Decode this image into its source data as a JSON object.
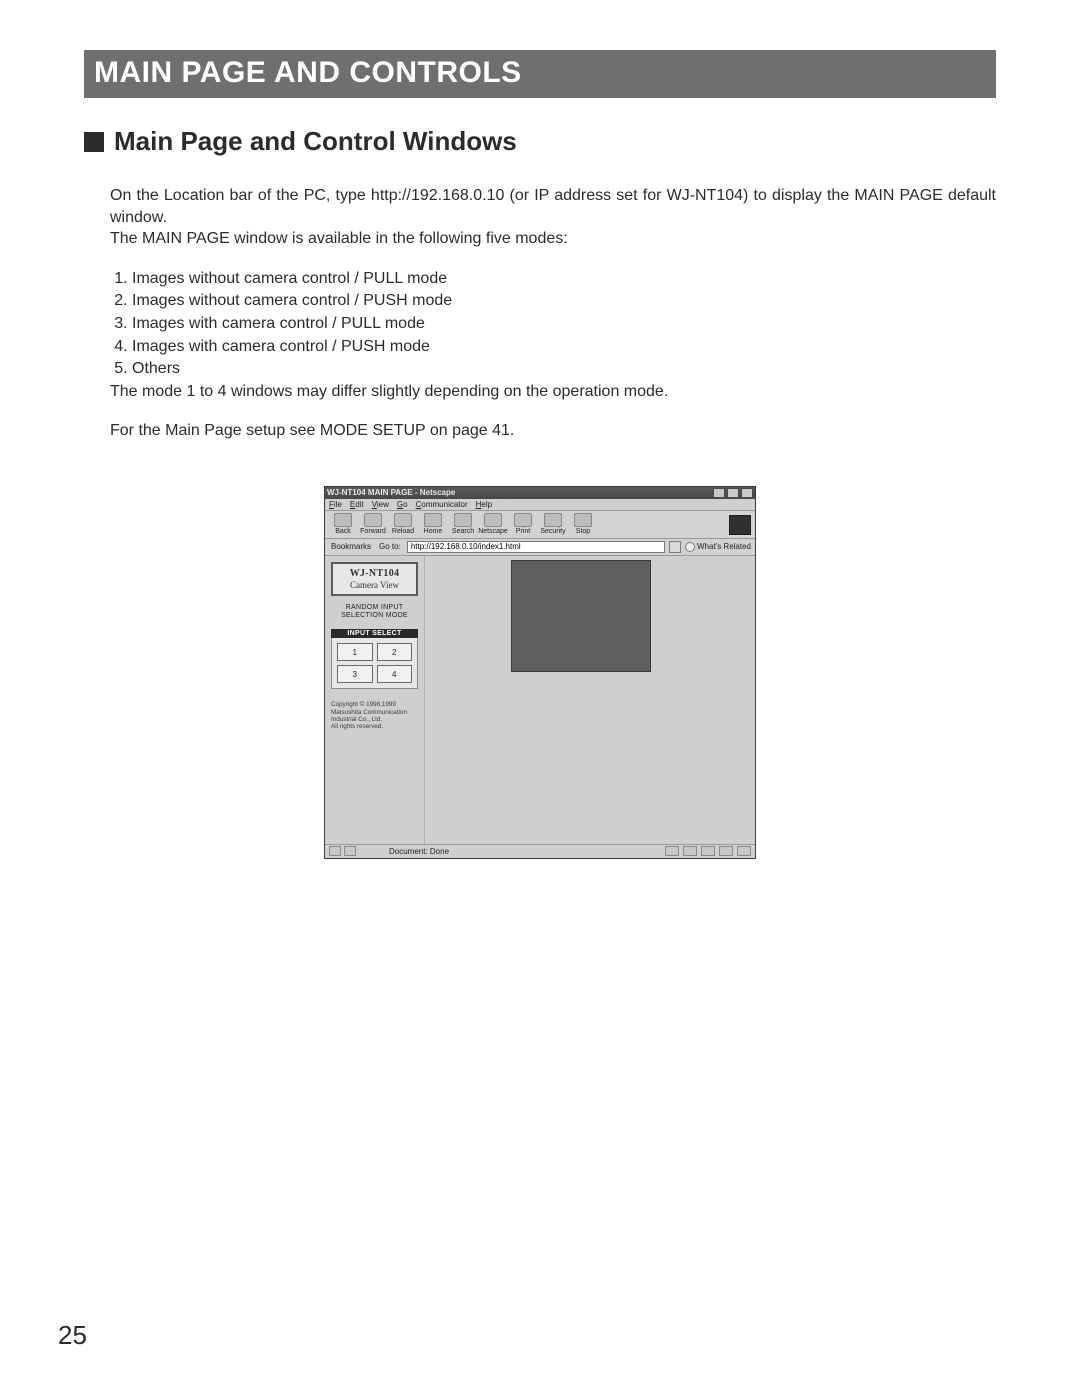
{
  "banner": "MAIN PAGE AND CONTROLS",
  "section_title": "Main Page and Control Windows",
  "intro_para": "On the Location bar of the PC, type http://192.168.0.10 (or IP address set for WJ-NT104) to display the MAIN PAGE default window.",
  "intro_line2": "The MAIN PAGE window is available in the following five modes:",
  "modes": [
    "Images without camera control / PULL mode",
    "Images without camera control / PUSH mode",
    "Images with camera control / PULL mode",
    "Images with camera control / PUSH mode",
    "Others"
  ],
  "note_after_list": "The mode 1 to 4 windows may differ slightly depending on the operation mode.",
  "setup_ref": "For the Main Page setup see MODE SETUP on page 41.",
  "page_number": "25",
  "screenshot": {
    "window_title": "WJ-NT104 MAIN PAGE - Netscape",
    "menus": [
      "File",
      "Edit",
      "View",
      "Go",
      "Communicator",
      "Help"
    ],
    "toolbar": [
      "Back",
      "Forward",
      "Reload",
      "Home",
      "Search",
      "Netscape",
      "Print",
      "Security",
      "Stop"
    ],
    "bookmarks_label": "Bookmarks",
    "goto_label": "Go to:",
    "url": "http://192.168.0.10/index1.html",
    "related_label": "What's Related",
    "sidebar": {
      "title": "WJ-NT104",
      "subtitle": "Camera View",
      "mode_line1": "RANDOM INPUT",
      "mode_line2": "SELECTION MODE",
      "input_select_header": "INPUT SELECT",
      "inputs": [
        "1",
        "2",
        "3",
        "4"
      ],
      "copyright_l1": "Copyright © 1998,1999",
      "copyright_l2": "Matsushita Communication",
      "copyright_l3": "Industrial Co., Ltd.",
      "copyright_l4": "All rights reserved."
    },
    "status_message": "Document: Done"
  }
}
